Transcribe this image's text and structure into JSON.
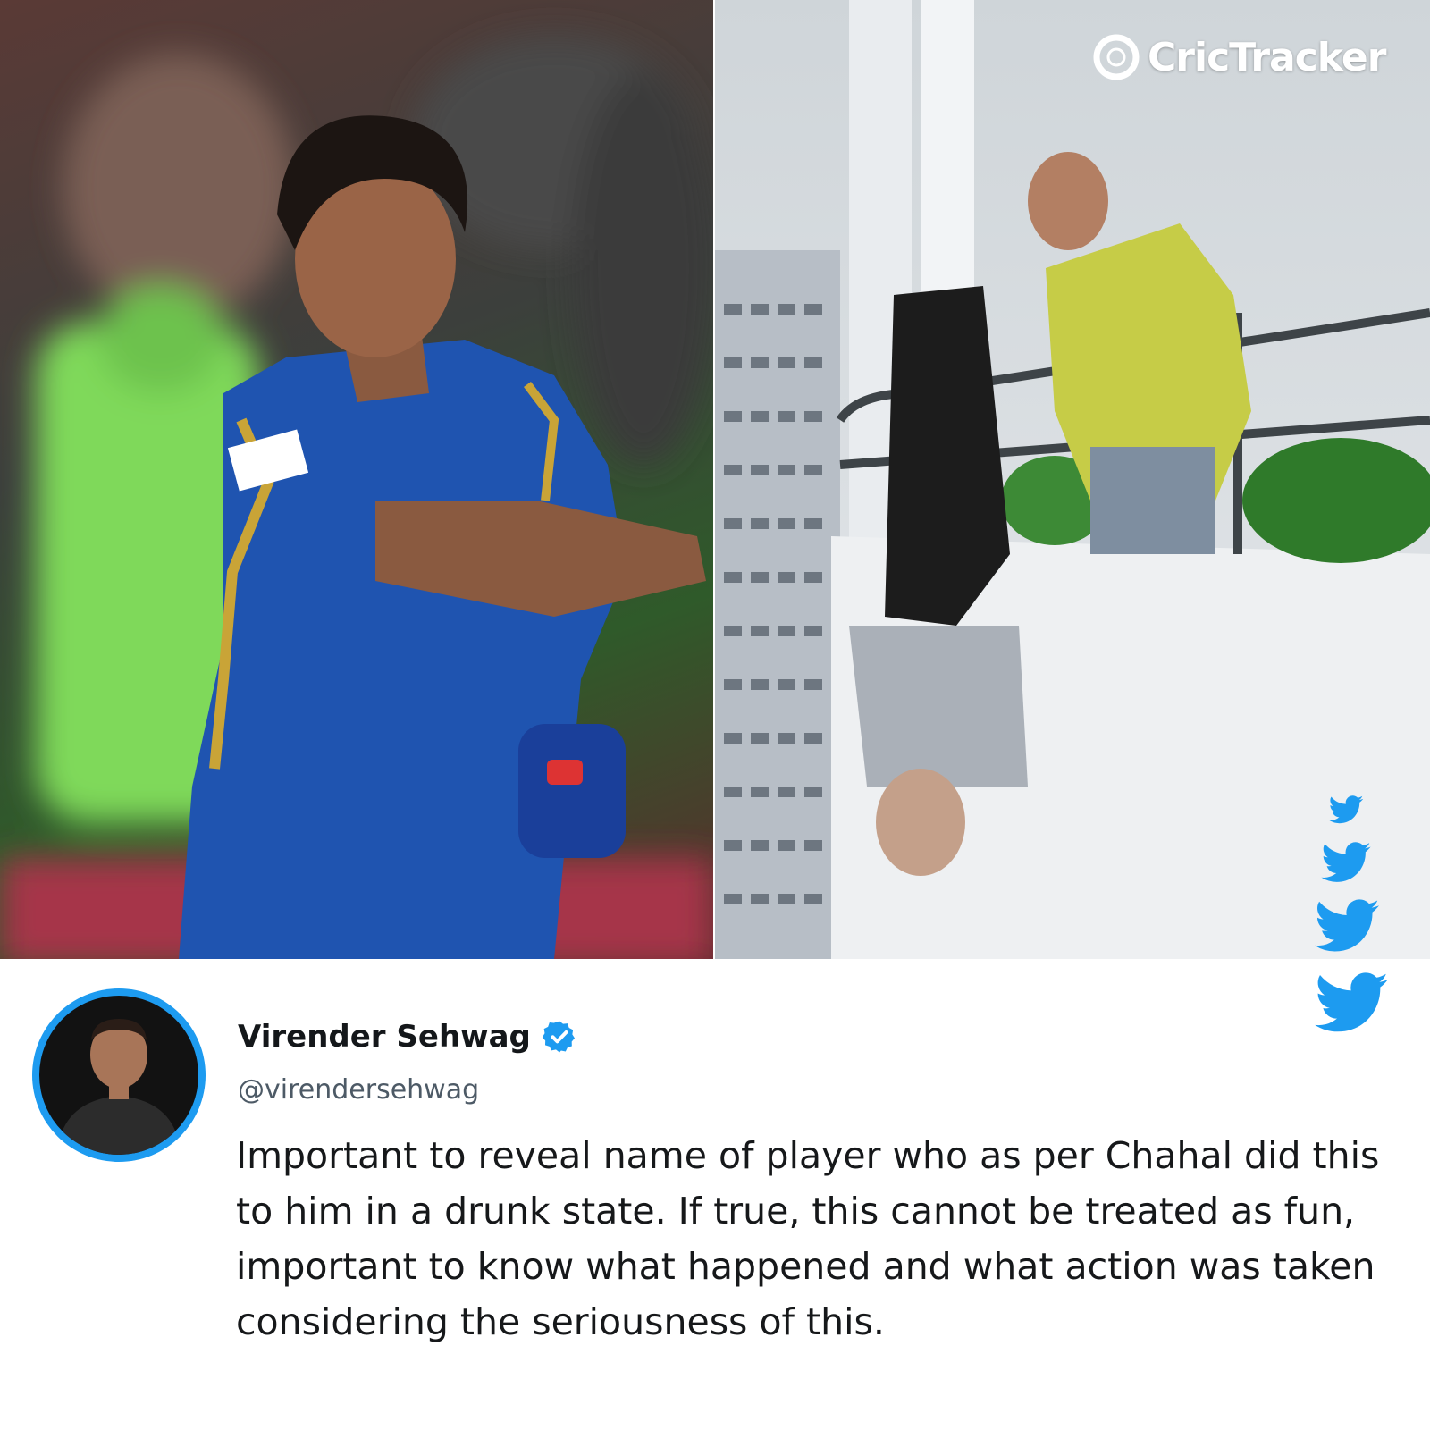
{
  "brand": {
    "name": "CricTracker"
  },
  "left_photo": {
    "description_icon": "cricketer-photo"
  },
  "right_photo": {
    "description_icon": "movie-still-photo"
  },
  "tweet": {
    "display_name": "Virender Sehwag",
    "verified": true,
    "handle": "@virendersehwag",
    "text": "Important to reveal name of player who as per Chahal did this to him in a drunk state. If true, this cannot be treated as fun, important to know what happened and what action was taken considering the seriousness of this."
  },
  "colors": {
    "twitter_blue": "#1d9bf0",
    "text_dark": "#16181a",
    "handle_gray": "#4d5a66",
    "background": "#ffffff"
  },
  "icons": [
    "crictracker-logo-icon",
    "twitter-bird-icon",
    "verified-badge-icon"
  ]
}
